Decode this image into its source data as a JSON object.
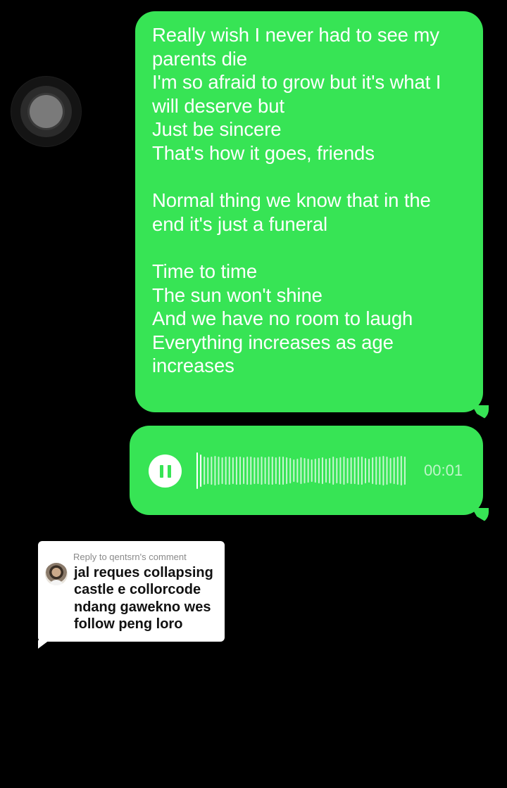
{
  "assistive_touch": {
    "icon": "assistive-touch-icon"
  },
  "text_message": {
    "lines": "Really wish I never had to see my\nparents die\nI'm so afraid to grow but it's what I\nwill deserve but\nJust be sincere\nThat's how it goes, friends\n\nNormal thing we know that in the\nend it's just a funeral\n\nTime to time\nThe sun won't shine\nAnd we have no room to laugh\nEverything increases as age\nincreases"
  },
  "voice_message": {
    "state_icon": "pause-icon",
    "duration": "00:01",
    "played_fraction": 0.03
  },
  "reply_card": {
    "header": "Reply to qentsrn's comment",
    "comment": "jal reques collapsing\ncastle e collorcode\nndang gawekno wes\nfollow peng loro"
  },
  "colors": {
    "bubble_green": "#37e455",
    "background": "#000000",
    "card_white": "#ffffff"
  }
}
